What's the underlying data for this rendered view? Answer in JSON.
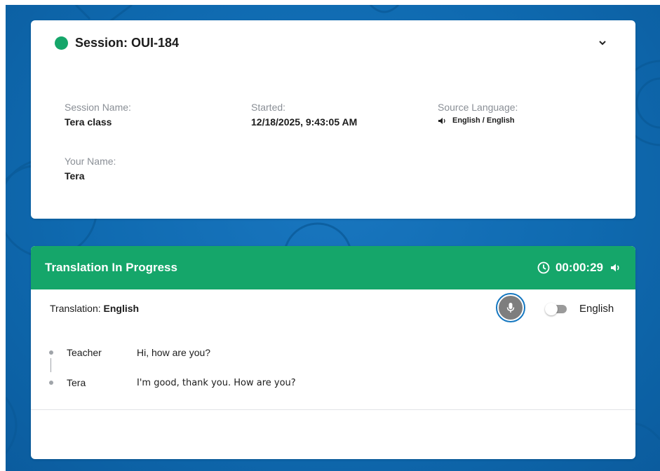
{
  "session": {
    "status_color": "#15a66a",
    "title": "Session: OUI-184",
    "fields": {
      "session_name_label": "Session Name:",
      "session_name_value": "Tera class",
      "started_label": "Started:",
      "started_value": "12/18/2025, 9:43:05 AM",
      "source_language_label": "Source Language:",
      "source_language_value": "English / English",
      "your_name_label": "Your Name:",
      "your_name_value": "Tera"
    },
    "collapse_icon": "chevron-down-icon"
  },
  "translation": {
    "header_title": "Translation In Progress",
    "header_color": "#15a66a",
    "timer": "00:00:29",
    "translation_label": "Translation:",
    "translation_language": "English",
    "toggle_label": "English",
    "toggle_on": false,
    "transcript": [
      {
        "speaker": "Teacher",
        "text": "Hi, how are you?"
      },
      {
        "speaker": "Tera",
        "text": "I'm good, thank you. How are you?"
      }
    ]
  },
  "theme": {
    "background": "#0f6ab0",
    "mic_ring": "#1577c0"
  }
}
